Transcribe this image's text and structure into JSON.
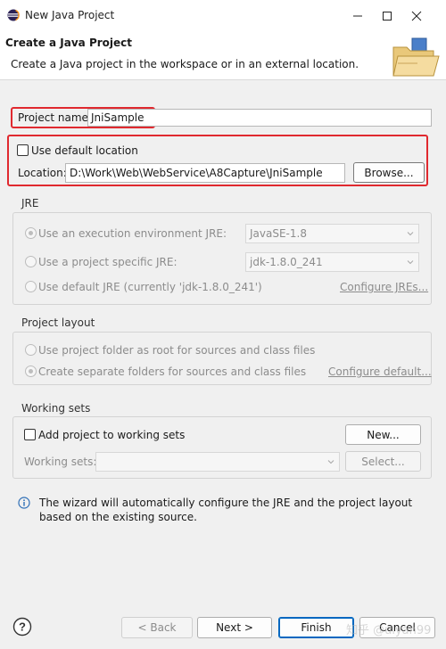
{
  "window": {
    "title": "New Java Project",
    "minimize_icon": "minimize-icon",
    "maximize_icon": "maximize-icon",
    "close_icon": "close-icon"
  },
  "header": {
    "title": "Create a Java Project",
    "description": "Create a Java project in the workspace or in an external location.",
    "image_icon": "folder-icon"
  },
  "project_name": {
    "label": "Project name:",
    "value": "JniSample"
  },
  "location": {
    "use_default_label": "Use default location",
    "use_default_checked": false,
    "location_label": "Location:",
    "location_value": "D:\\Work\\Web\\WebService\\A8Capture\\JniSample",
    "browse_button": "Browse..."
  },
  "jre": {
    "title": "JRE",
    "option_env_label": "Use an execution environment JRE:",
    "option_env_value": "JavaSE-1.8",
    "option_specific_label": "Use a project specific JRE:",
    "option_specific_value": "jdk-1.8.0_241",
    "option_default_label": "Use default JRE (currently 'jdk-1.8.0_241')",
    "configure_link": "Configure JREs..."
  },
  "project_layout": {
    "title": "Project layout",
    "option_root_label": "Use project folder as root for sources and class files",
    "option_separate_label": "Create separate folders for sources and class files",
    "configure_link": "Configure default..."
  },
  "working_sets": {
    "title": "Working sets",
    "add_label": "Add project to working sets",
    "add_checked": false,
    "new_button": "New...",
    "sets_label": "Working sets:",
    "sets_value": "",
    "select_button": "Select..."
  },
  "info": {
    "icon": "info-icon",
    "message": "The wizard will automatically configure the JRE and the project layout based on the existing source."
  },
  "footer": {
    "help_icon": "help-icon",
    "back_button": "< Back",
    "next_button": "Next >",
    "finish_button": "Finish",
    "cancel_button": "Cancel"
  },
  "watermark": "知乎 @ulyan99",
  "colors": {
    "highlight": "#e0292f",
    "primary_border": "#0067c0",
    "disabled_text": "#8c8c8c"
  }
}
